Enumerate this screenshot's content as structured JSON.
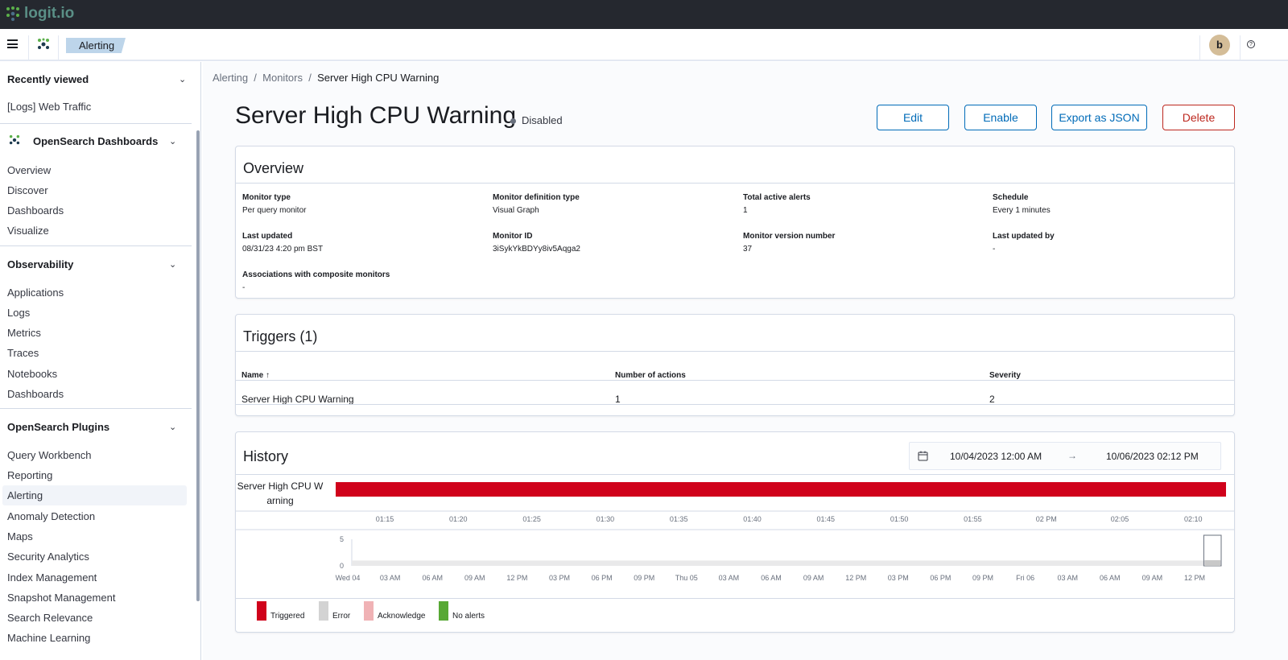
{
  "brand": {
    "name": "logit.io"
  },
  "header": {
    "breadcrumb": "Alerting",
    "avatar_initial": "b"
  },
  "sidebar": {
    "recent": {
      "title": "Recently viewed",
      "items": [
        "[Logs] Web Traffic"
      ]
    },
    "sections": [
      {
        "title": "OpenSearch Dashboards",
        "items": [
          "Overview",
          "Discover",
          "Dashboards",
          "Visualize"
        ]
      },
      {
        "title": "Observability",
        "items": [
          "Applications",
          "Logs",
          "Metrics",
          "Traces",
          "Notebooks",
          "Dashboards"
        ]
      },
      {
        "title": "OpenSearch Plugins",
        "items": [
          "Query Workbench",
          "Reporting",
          "Alerting",
          "Anomaly Detection",
          "Maps",
          "Security Analytics",
          "Index Management",
          "Snapshot Management",
          "Search Relevance",
          "Machine Learning"
        ]
      }
    ],
    "active": "Alerting"
  },
  "breadcrumbs": [
    "Alerting",
    "Monitors",
    "Server High CPU Warning"
  ],
  "monitor": {
    "title": "Server High CPU Warning",
    "status": "Disabled"
  },
  "actions": {
    "edit": "Edit",
    "enable": "Enable",
    "export": "Export as JSON",
    "delete": "Delete"
  },
  "overview": {
    "title": "Overview",
    "fields": [
      {
        "label": "Monitor type",
        "value": "Per query monitor"
      },
      {
        "label": "Monitor definition type",
        "value": "Visual Graph"
      },
      {
        "label": "Total active alerts",
        "value": "1"
      },
      {
        "label": "Schedule",
        "value": "Every 1 minutes"
      },
      {
        "label": "Last updated",
        "value": "08/31/23 4:20 pm BST"
      },
      {
        "label": "Monitor ID",
        "value": "3iSykYkBDYy8iv5Aqga2"
      },
      {
        "label": "Monitor version number",
        "value": "37"
      },
      {
        "label": "Last updated by",
        "value": "-"
      },
      {
        "label": "Associations with composite monitors",
        "value": "-"
      }
    ]
  },
  "triggers": {
    "title": "Triggers (1)",
    "columns": [
      "Name",
      "Number of actions",
      "Severity"
    ],
    "sort_icon": "↑",
    "rows": [
      {
        "name": "Server High CPU Warning",
        "actions": "1",
        "severity": "2"
      }
    ]
  },
  "history": {
    "title": "History",
    "date_from": "10/04/2023 12:00 AM",
    "date_to": "10/06/2023 02:12 PM",
    "arrow": "→",
    "legend": [
      {
        "label": "Triggered",
        "color": "#d0021b"
      },
      {
        "label": "Error",
        "color": "#d3d3d3"
      },
      {
        "label": "Acknowledge",
        "color": "#f0b2b5"
      },
      {
        "label": "No alerts",
        "color": "#57a834"
      }
    ]
  },
  "chart_data": [
    {
      "type": "timeline",
      "series_label": "Server High CPU W arning",
      "state": "Triggered",
      "color": "#d0021b",
      "x_ticks": [
        "01:15",
        "01:20",
        "01:25",
        "01:30",
        "01:35",
        "01:40",
        "01:45",
        "01:50",
        "01:55",
        "02 PM",
        "02:05",
        "02:10"
      ],
      "bar_coverage": [
        0,
        1
      ]
    },
    {
      "type": "area",
      "y_ticks": [
        "0",
        "5"
      ],
      "ylim": [
        0,
        5
      ],
      "x_ticks": [
        "Wed 04",
        "03 AM",
        "06 AM",
        "09 AM",
        "12 PM",
        "03 PM",
        "06 PM",
        "09 PM",
        "Thu 05",
        "03 AM",
        "06 AM",
        "09 AM",
        "12 PM",
        "03 PM",
        "06 PM",
        "09 PM",
        "Fri 06",
        "03 AM",
        "06 AM",
        "09 AM",
        "12 PM"
      ],
      "value": 1,
      "brush_range": [
        0.98,
        1
      ]
    }
  ]
}
